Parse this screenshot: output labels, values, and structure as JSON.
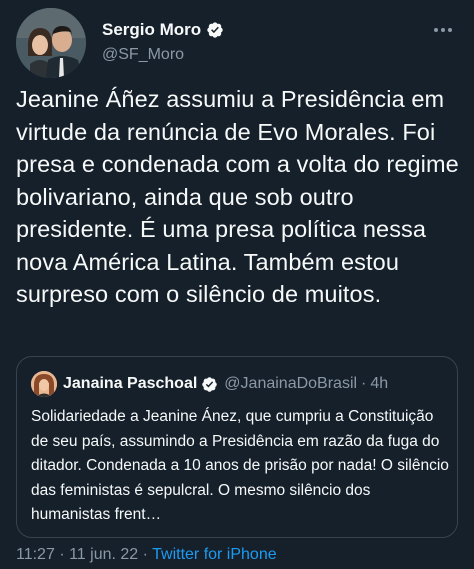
{
  "author": {
    "name": "Sergio Moro",
    "handle": "@SF_Moro"
  },
  "tweet": {
    "text": "Jeanine Áñez assumiu a Presidência em virtude da renúncia de Evo Morales. Foi presa e condenada com a volta do regime bolivariano, ainda que sob outro presidente. É uma presa política nessa nova América Latina. Também estou surpreso com o silêncio de muitos."
  },
  "quote": {
    "name": "Janaina Paschoal",
    "handle": "@JanainaDoBrasil",
    "separator": "·",
    "time": "4h",
    "text": "Solidariedade a Jeanine Ánez, que cumpriu a Constituição de seu país, assumindo a Presidência em razão da fuga do ditador. Condenada a 10 anos de prisão por nada! O silêncio das feministas é sepulcral. O mesmo silêncio dos humanistas frent…"
  },
  "meta": {
    "time": "11:27",
    "sep1": "·",
    "date": "11 jun. 22",
    "sep2": "·",
    "source": "Twitter for iPhone"
  },
  "colors": {
    "background": "#15202b",
    "text": "#f7f9f9",
    "secondary": "#8b98a5",
    "accent": "#1d9bf0",
    "border": "#38444d"
  },
  "icons": {
    "verified": "verified-badge-icon",
    "more": "more-options-icon"
  }
}
